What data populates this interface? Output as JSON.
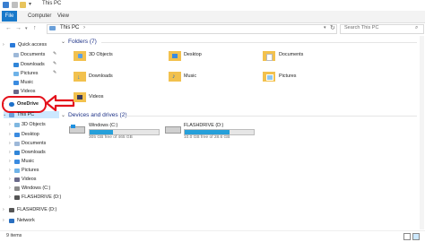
{
  "window": {
    "title": "This PC"
  },
  "ribbon": {
    "tabs": [
      "File",
      "Computer",
      "View"
    ]
  },
  "address": {
    "path": "This PC",
    "search_placeholder": "Search This PC"
  },
  "nav": {
    "quick_access": "Quick access",
    "quick_items": [
      "Documents",
      "Downloads",
      "Pictures",
      "Music",
      "Videos"
    ],
    "onedrive": "OneDrive",
    "this_pc": "This PC",
    "pc_items": [
      "3D Objects",
      "Desktop",
      "Documents",
      "Downloads",
      "Music",
      "Pictures",
      "Videos",
      "Windows (C:)",
      "FLASHDRIVE (D:)"
    ],
    "flashdrive_root": "FLASHDRIVE (D:)",
    "network": "Network"
  },
  "content": {
    "folders_header": "Folders (7)",
    "folders": [
      "3D Objects",
      "Desktop",
      "Documents",
      "Downloads",
      "Music",
      "Pictures",
      "Videos"
    ],
    "drives_header": "Devices and drives (2)",
    "drives": [
      {
        "name": "Windows (C:)",
        "detail": "305 GB free of 465 GB",
        "used_fraction": 0.34
      },
      {
        "name": "FLASHDRIVE (D:)",
        "detail": "10.0 GB free of 28.6 GB",
        "used_fraction": 0.65
      }
    ]
  },
  "status": {
    "count": "9 items"
  },
  "colors": {
    "accent": "#1979ca",
    "folder": "#f2c14e",
    "highlight": "#cce8ff",
    "callout": "#e4111b",
    "bar_fill": "#26a0da"
  }
}
